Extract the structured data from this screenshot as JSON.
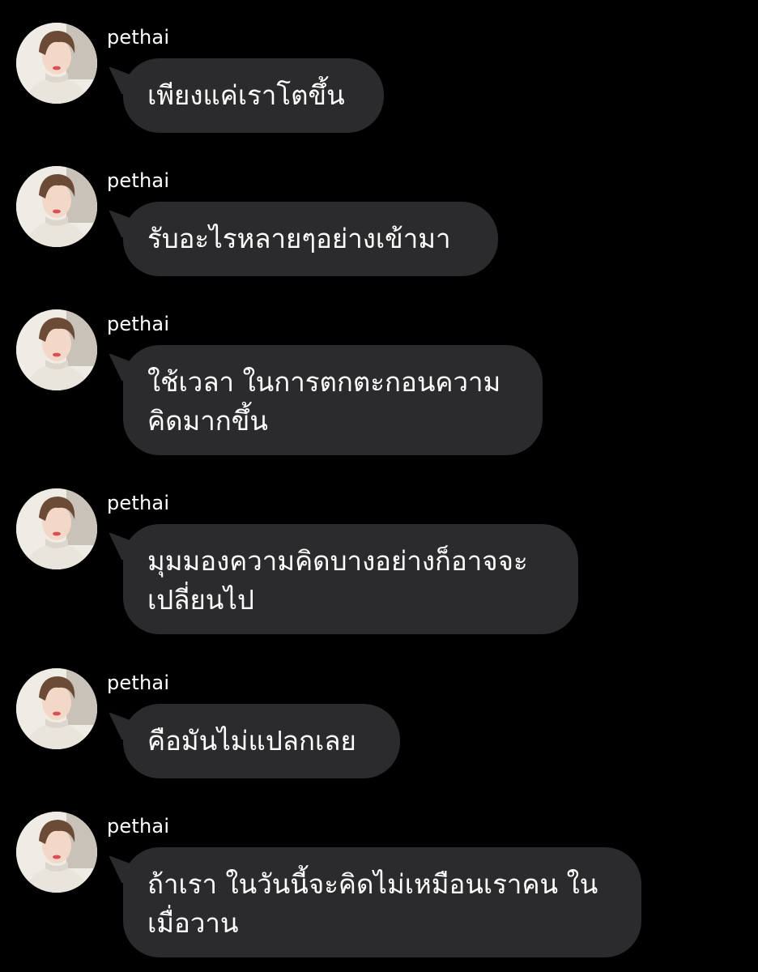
{
  "messages": [
    {
      "username": "pethai",
      "text": "เพียงแค่เราโตขึ้น"
    },
    {
      "username": "pethai",
      "text": "รับอะไรหลายๆอย่างเข้ามา"
    },
    {
      "username": "pethai",
      "text": "ใช้เวลา ในการตกตะกอนความ\nคิดมากขึ้น"
    },
    {
      "username": "pethai",
      "text": "มุมมองความคิดบางอย่างก็อาจจะ\nเปลี่ยนไป"
    },
    {
      "username": "pethai",
      "text": "คือมันไม่แปลกเลย"
    },
    {
      "username": "pethai",
      "text": "ถ้าเรา ในวันนี้จะคิดไม่เหมือนเราคน ใน\nเมื่อวาน"
    }
  ],
  "colors": {
    "background": "#000000",
    "bubble": "#2b2b2d",
    "text": "#ffffff"
  },
  "icons": {
    "avatar": "profile-photo"
  }
}
